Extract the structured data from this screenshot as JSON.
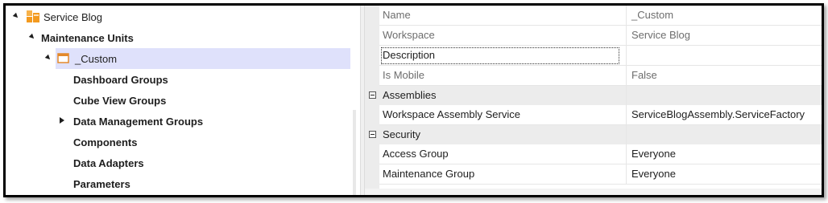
{
  "tree": {
    "root": {
      "label": "Service Blog",
      "icon": "workspace-icon"
    },
    "maintenance_units": {
      "label": "Maintenance Units"
    },
    "custom_unit": {
      "label": "_Custom",
      "icon": "maintenance-unit-icon"
    },
    "children": [
      {
        "label": "Dashboard Groups"
      },
      {
        "label": "Cube View Groups"
      },
      {
        "label": "Data Management Groups"
      },
      {
        "label": "Components"
      },
      {
        "label": "Data Adapters"
      },
      {
        "label": "Parameters"
      }
    ]
  },
  "properties": {
    "rows": [
      {
        "name": "Name",
        "value": "_Custom"
      },
      {
        "name": "Workspace",
        "value": "Service Blog"
      },
      {
        "name": "Description",
        "value": ""
      },
      {
        "name": "Is Mobile",
        "value": "False"
      }
    ],
    "assemblies": {
      "label": "Assemblies",
      "rows": [
        {
          "name": "Workspace Assembly Service",
          "value": "ServiceBlogAssembly.ServiceFactory"
        }
      ]
    },
    "security": {
      "label": "Security",
      "rows": [
        {
          "name": "Access Group",
          "value": "Everyone"
        },
        {
          "name": "Maintenance Group",
          "value": "Everyone"
        }
      ]
    }
  },
  "colors": {
    "selection": "#dfe1fb",
    "workspace_icon": "#f39a1f",
    "category_bg": "#ececec"
  }
}
